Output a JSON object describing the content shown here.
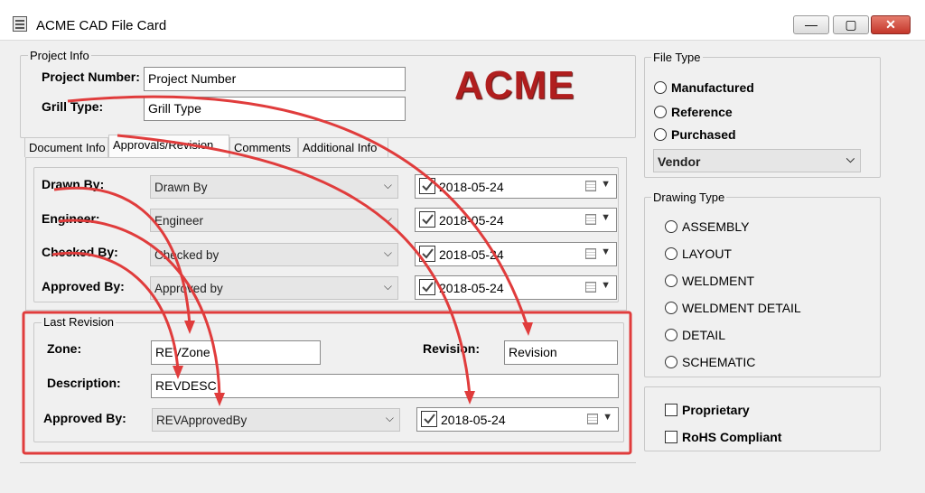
{
  "window": {
    "title": "ACME CAD File Card",
    "minimize": "—",
    "maximize": "▢",
    "close": "✕"
  },
  "project_info": {
    "legend": "Project Info",
    "project_number_label": "Project Number:",
    "project_number_value": "Project Number",
    "grill_type_label": "Grill Type:",
    "grill_type_value": "Grill Type",
    "logo_text": "ACME"
  },
  "tabs": [
    {
      "label": "Document Info"
    },
    {
      "label": "Approvals/Revision"
    },
    {
      "label": "Comments"
    },
    {
      "label": "Additional Info"
    }
  ],
  "approvals": {
    "rows": [
      {
        "label": "Drawn By:",
        "combo": "Drawn By",
        "date": "2018-05-24"
      },
      {
        "label": "Engineer:",
        "combo": "Engineer",
        "date": "2018-05-24"
      },
      {
        "label": "Checked By:",
        "combo": "Checked by",
        "date": "2018-05-24"
      },
      {
        "label": "Approved By:",
        "combo": "Approved by",
        "date": "2018-05-24"
      }
    ]
  },
  "last_revision": {
    "legend": "Last Revision",
    "zone_label": "Zone:",
    "zone_value": "REVZone",
    "revision_label": "Revision:",
    "revision_value": "Revision",
    "description_label": "Description:",
    "description_value": "REVDESC",
    "approved_by_label": "Approved By:",
    "approved_by_value": "REVApprovedBy",
    "date": "2018-05-24"
  },
  "file_type": {
    "legend": "File Type",
    "options": [
      "Manufactured",
      "Reference",
      "Purchased"
    ],
    "vendor": "Vendor"
  },
  "drawing_type": {
    "legend": "Drawing Type",
    "options": [
      "ASSEMBLY",
      "LAYOUT",
      "WELDMENT",
      "WELDMENT DETAIL",
      "DETAIL",
      "SCHEMATIC"
    ]
  },
  "flags": {
    "options": [
      "Proprietary",
      "RoHS Compliant"
    ]
  },
  "colors": {
    "annotation_red": "#e03c3c",
    "logo_red": "#b01e1e"
  }
}
